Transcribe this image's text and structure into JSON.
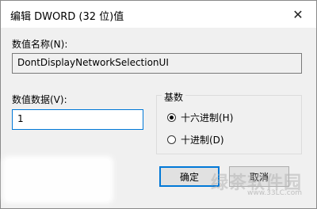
{
  "window": {
    "title": "编辑 DWORD (32 位)值",
    "close_glyph": "✕"
  },
  "value_name": {
    "label": "数值名称(N):",
    "value": "DontDisplayNetworkSelectionUI"
  },
  "value_data": {
    "label": "数值数据(V):",
    "value": "1"
  },
  "base": {
    "title": "基数",
    "options": [
      {
        "label": "十六进制(H)",
        "selected": true
      },
      {
        "label": "十进制(D)",
        "selected": false
      }
    ]
  },
  "buttons": {
    "ok": "确定",
    "cancel": "取消"
  },
  "watermark": {
    "text": "绿茶软件园",
    "url": "www.33LC.com"
  }
}
